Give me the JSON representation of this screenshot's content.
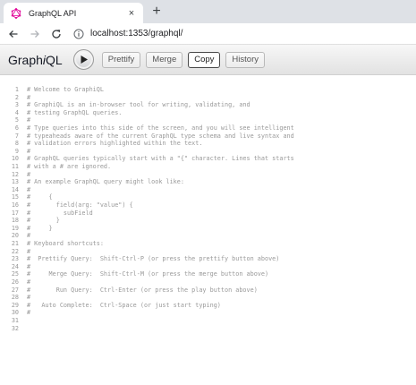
{
  "browser": {
    "tab_title": "GraphQL API",
    "tab_close": "×",
    "new_tab": "+",
    "url": "localhost:1353/graphql/"
  },
  "graphiql": {
    "title_plain": "Graph",
    "title_italic": "i",
    "title_end": "QL",
    "buttons": {
      "prettify": "Prettify",
      "merge": "Merge",
      "copy": "Copy",
      "history": "History"
    }
  },
  "editor": {
    "lines": [
      {
        "n": "1",
        "text": "# Welcome to GraphiQL"
      },
      {
        "n": "2",
        "text": "#"
      },
      {
        "n": "3",
        "text": "# GraphiQL is an in-browser tool for writing, validating, and"
      },
      {
        "n": "4",
        "text": "# testing GraphQL queries."
      },
      {
        "n": "5",
        "text": "#"
      },
      {
        "n": "6",
        "text": "# Type queries into this side of the screen, and you will see intelligent"
      },
      {
        "n": "7",
        "text": "# typeaheads aware of the current GraphQL type schema and live syntax and"
      },
      {
        "n": "8",
        "text": "# validation errors highlighted within the text."
      },
      {
        "n": "9",
        "text": "#"
      },
      {
        "n": "10",
        "text": "# GraphQL queries typically start with a \"{\" character. Lines that starts"
      },
      {
        "n": "11",
        "text": "# with a # are ignored."
      },
      {
        "n": "12",
        "text": "#"
      },
      {
        "n": "13",
        "text": "# An example GraphQL query might look like:"
      },
      {
        "n": "14",
        "text": "#"
      },
      {
        "n": "15",
        "text": "#     {"
      },
      {
        "n": "16",
        "text": "#       field(arg: \"value\") {"
      },
      {
        "n": "17",
        "text": "#         subField"
      },
      {
        "n": "18",
        "text": "#       }"
      },
      {
        "n": "19",
        "text": "#     }"
      },
      {
        "n": "20",
        "text": "#"
      },
      {
        "n": "21",
        "text": "# Keyboard shortcuts:"
      },
      {
        "n": "22",
        "text": "#"
      },
      {
        "n": "23",
        "text": "#  Prettify Query:  Shift-Ctrl-P (or press the prettify button above)"
      },
      {
        "n": "24",
        "text": "#"
      },
      {
        "n": "25",
        "text": "#     Merge Query:  Shift-Ctrl-M (or press the merge button above)"
      },
      {
        "n": "26",
        "text": "#"
      },
      {
        "n": "27",
        "text": "#       Run Query:  Ctrl-Enter (or press the play button above)"
      },
      {
        "n": "28",
        "text": "#"
      },
      {
        "n": "29",
        "text": "#   Auto Complete:  Ctrl-Space (or just start typing)"
      },
      {
        "n": "30",
        "text": "#"
      },
      {
        "n": "31",
        "text": ""
      },
      {
        "n": "32",
        "text": ""
      }
    ]
  },
  "colors": {
    "comment": "#999999",
    "graphql_pink": "#e10098",
    "toolbar_gradient_top": "#f7f7f7",
    "toolbar_gradient_bottom": "#e2e2e2"
  },
  "icons": [
    "graphql-favicon",
    "back-arrow-icon",
    "forward-arrow-icon",
    "reload-icon",
    "info-icon",
    "play-icon"
  ]
}
